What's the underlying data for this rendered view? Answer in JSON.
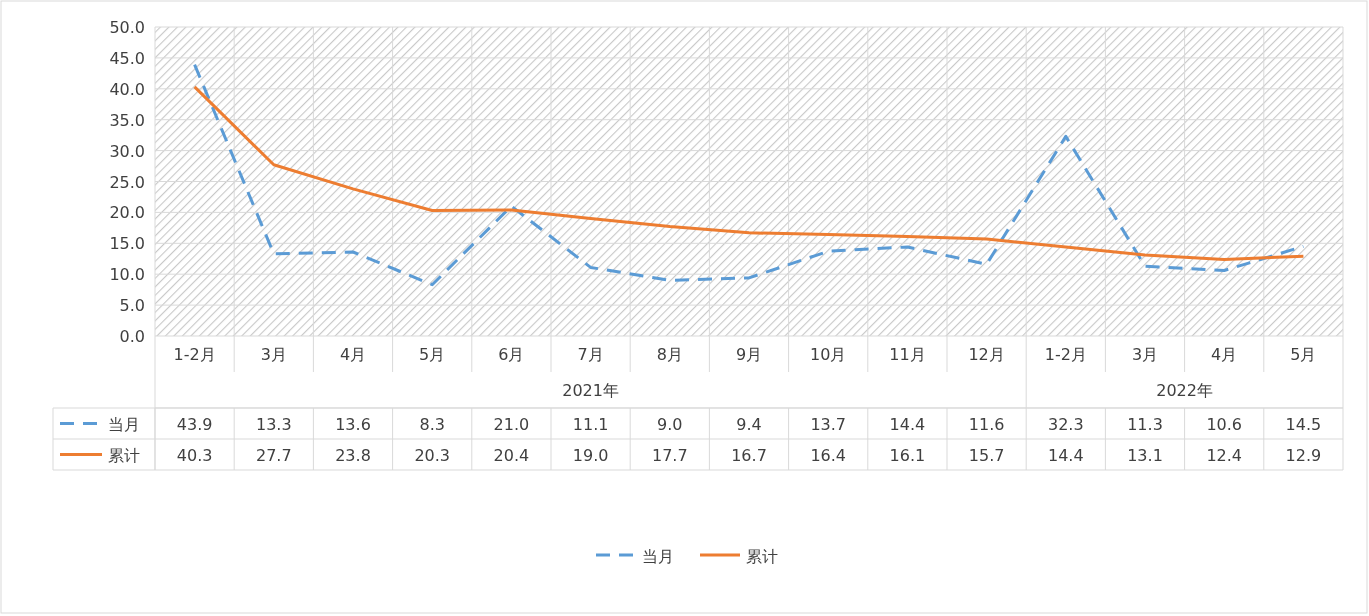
{
  "chart": {
    "chart_data": {
      "type": "line",
      "categories": [
        "1-2月",
        "3月",
        "4月",
        "5月",
        "6月",
        "7月",
        "8月",
        "9月",
        "10月",
        "11月",
        "12月",
        "1-2月",
        "3月",
        "4月",
        "5月"
      ],
      "series": [
        {
          "name": "当月",
          "color": "#5b9bd5",
          "line_style": "dashed",
          "values": [
            43.9,
            13.3,
            13.6,
            8.3,
            21.0,
            11.1,
            9.0,
            9.4,
            13.7,
            14.4,
            11.6,
            32.3,
            11.3,
            10.6,
            14.5
          ]
        },
        {
          "name": "累计",
          "color": "#ed7d31",
          "line_style": "solid",
          "values": [
            40.3,
            27.7,
            23.8,
            20.3,
            20.4,
            19.0,
            17.7,
            16.7,
            16.4,
            16.1,
            15.7,
            14.4,
            13.1,
            12.4,
            12.9
          ]
        }
      ],
      "ylim": [
        0,
        50
      ],
      "grid": true,
      "legend": "bottom",
      "yticks": [
        {
          "value": 0,
          "label": "0.0"
        },
        {
          "value": 5,
          "label": "5.0"
        },
        {
          "value": 10,
          "label": "10.0"
        },
        {
          "value": 15,
          "label": "15.0"
        },
        {
          "value": 20,
          "label": "20.0"
        },
        {
          "value": 25,
          "label": "25.0"
        },
        {
          "value": 30,
          "label": "30.0"
        },
        {
          "value": 35,
          "label": "35.0"
        },
        {
          "value": 40,
          "label": "40.0"
        },
        {
          "value": 45,
          "label": "45.0"
        },
        {
          "value": 50,
          "label": "50.0"
        }
      ],
      "value_labels": [
        [
          "43.9",
          "13.3",
          "13.6",
          "8.3",
          "21.0",
          "11.1",
          "9.0",
          "9.4",
          "13.7",
          "14.4",
          "11.6",
          "32.3",
          "11.3",
          "10.6",
          "14.5"
        ],
        [
          "40.3",
          "27.7",
          "23.8",
          "20.3",
          "20.4",
          "19.0",
          "17.7",
          "16.7",
          "16.4",
          "16.1",
          "15.7",
          "14.4",
          "13.1",
          "12.4",
          "12.9"
        ]
      ]
    },
    "category_groups": [
      {
        "label": "2021年"
      },
      {
        "label": "2022年"
      }
    ]
  }
}
